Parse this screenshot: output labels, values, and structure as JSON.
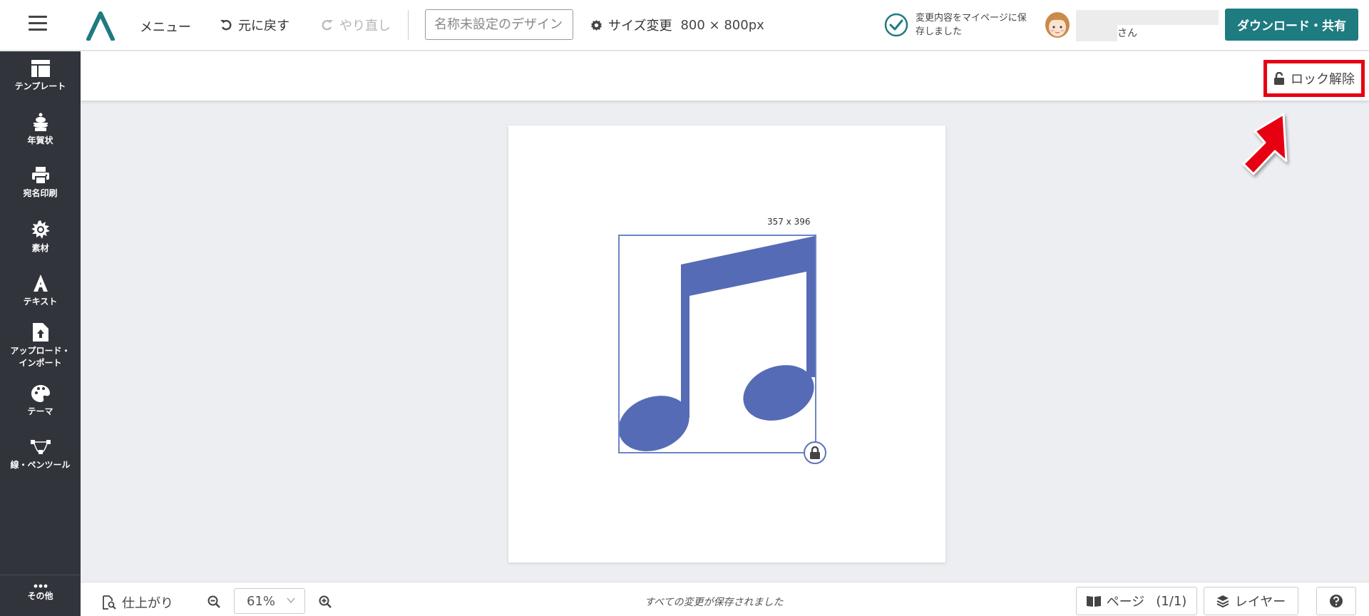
{
  "header": {
    "menu_label": "メニュー",
    "undo_label": "元に戻す",
    "redo_label": "やり直し",
    "design_name_placeholder": "名称未設定のデザイン",
    "resize_label": "サイズ変更",
    "size_value": "800 × 800px",
    "saved_status": "変更内容をマイページに保存しました",
    "user_suffix": "さん",
    "download_label": "ダウンロード・共有"
  },
  "sidebar": {
    "items": [
      {
        "label": "テンプレート",
        "icon": "template-icon"
      },
      {
        "label": "年賀状",
        "icon": "kagami-mochi-icon"
      },
      {
        "label": "宛名印刷",
        "icon": "printer-icon"
      },
      {
        "label": "素材",
        "icon": "sun-icon"
      },
      {
        "label": "テキスト",
        "icon": "text-a-icon"
      },
      {
        "label": "アップロード・インポート",
        "label_line1": "アップロード・",
        "label_line2": "インポート",
        "icon": "upload-file-icon"
      },
      {
        "label": "テーマ",
        "icon": "palette-icon"
      },
      {
        "label": "線・ペンツール",
        "icon": "vector-pen-icon"
      }
    ],
    "more_label": "その他"
  },
  "toolbar": {
    "unlock_label": "ロック解除"
  },
  "canvas": {
    "selection_size": "357 x 396",
    "note_color": "#566bb5",
    "selection_color": "#6b85c6"
  },
  "bottom": {
    "preview_label": "仕上がり",
    "zoom_value": "61%",
    "save_status": "すべての変更が保存されました",
    "page_label": "ページ",
    "page_count": "(1/1)",
    "layer_label": "レイヤー"
  },
  "colors": {
    "brand": "#1e7b80",
    "sidebar_bg": "#31343b",
    "highlight": "#e60012"
  }
}
